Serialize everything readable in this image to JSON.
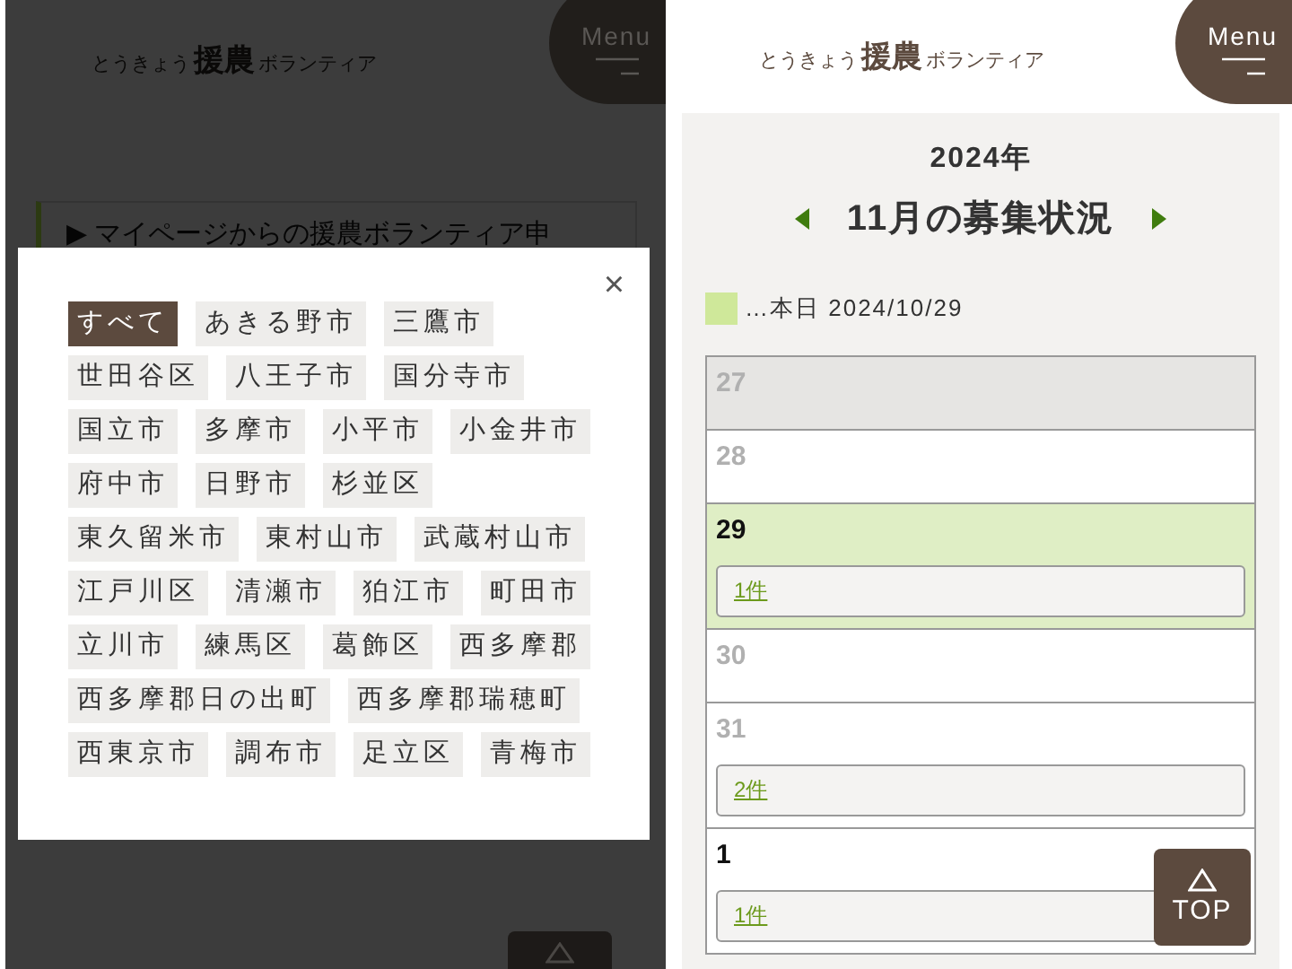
{
  "left_screen": {
    "logo": {
      "small": "とうきょう",
      "big": "援農",
      "tail": "ボランティア"
    },
    "menu_button": "Menu",
    "card_marker": "▶",
    "card_heading": "マイページからの援農ボランティア申",
    "modal": {
      "close": "×",
      "areas": [
        {
          "label": "すべて",
          "selected": true
        },
        {
          "label": "あきる野市",
          "selected": false
        },
        {
          "label": "三鷹市",
          "selected": false
        },
        {
          "label": "世田谷区",
          "selected": false
        },
        {
          "label": "八王子市",
          "selected": false
        },
        {
          "label": "国分寺市",
          "selected": false
        },
        {
          "label": "国立市",
          "selected": false
        },
        {
          "label": "多摩市",
          "selected": false
        },
        {
          "label": "小平市",
          "selected": false
        },
        {
          "label": "小金井市",
          "selected": false
        },
        {
          "label": "府中市",
          "selected": false
        },
        {
          "label": "日野市",
          "selected": false
        },
        {
          "label": "杉並区",
          "selected": false
        },
        {
          "label": "東久留米市",
          "selected": false
        },
        {
          "label": "東村山市",
          "selected": false
        },
        {
          "label": "武蔵村山市",
          "selected": false
        },
        {
          "label": "江戸川区",
          "selected": false
        },
        {
          "label": "清瀬市",
          "selected": false
        },
        {
          "label": "狛江市",
          "selected": false
        },
        {
          "label": "町田市",
          "selected": false
        },
        {
          "label": "立川市",
          "selected": false
        },
        {
          "label": "練馬区",
          "selected": false
        },
        {
          "label": "葛飾区",
          "selected": false
        },
        {
          "label": "西多摩郡",
          "selected": false
        },
        {
          "label": "西多摩郡日の出町",
          "selected": false
        },
        {
          "label": "西多摩郡瑞穂町",
          "selected": false
        },
        {
          "label": "西東京市",
          "selected": false
        },
        {
          "label": "調布市",
          "selected": false
        },
        {
          "label": "足立区",
          "selected": false
        },
        {
          "label": "青梅市",
          "selected": false
        }
      ]
    }
  },
  "right_screen": {
    "logo": {
      "small": "とうきょう",
      "big": "援農",
      "tail": "ボランティア"
    },
    "menu_button": "Menu",
    "year": "2024年",
    "month_title": "11月の募集状況",
    "legend": "…本日 2024/10/29",
    "days": [
      {
        "day": "27",
        "muted": true,
        "shaded": true,
        "today": false
      },
      {
        "day": "28",
        "muted": true,
        "shaded": false,
        "today": false
      },
      {
        "day": "29",
        "muted": false,
        "shaded": false,
        "today": true,
        "events": "1件"
      },
      {
        "day": "30",
        "muted": true,
        "shaded": false,
        "today": false
      },
      {
        "day": "31",
        "muted": true,
        "shaded": false,
        "today": false,
        "events": "2件"
      },
      {
        "day": "1",
        "muted": false,
        "shaded": false,
        "today": false,
        "events": "1件"
      }
    ],
    "top_button": "TOP"
  }
}
